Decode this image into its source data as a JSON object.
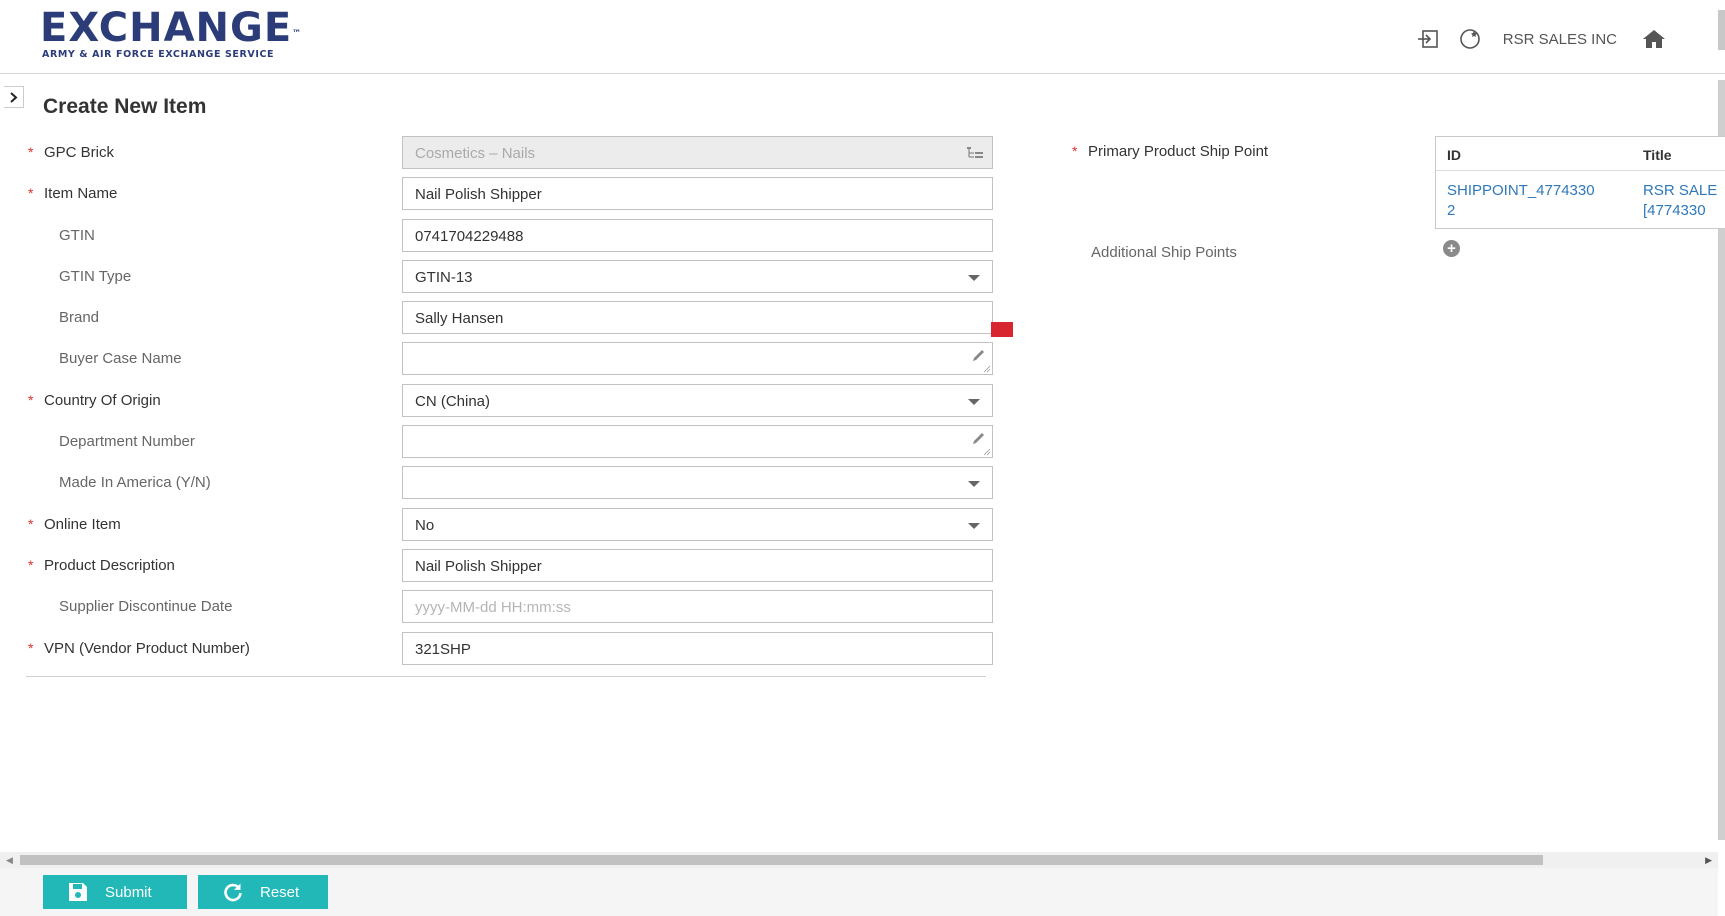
{
  "header": {
    "logo_text": "EXCHANGE",
    "logo_tm": "™",
    "logo_subtitle": "ARMY & AIR FORCE EXCHANGE SERVICE",
    "company": "RSR SALES INC"
  },
  "page": {
    "title": "Create New Item"
  },
  "form": {
    "fields": [
      {
        "label": "GPC Brick",
        "required": true,
        "value": "Cosmetics – Nails",
        "type": "tree"
      },
      {
        "label": "Item Name",
        "required": true,
        "value": "Nail Polish Shipper",
        "type": "text"
      },
      {
        "label": "GTIN",
        "required": false,
        "value": "0741704229488",
        "type": "text"
      },
      {
        "label": "GTIN Type",
        "required": false,
        "value": "GTIN-13",
        "type": "select"
      },
      {
        "label": "Brand",
        "required": false,
        "value": "Sally Hansen",
        "type": "text"
      },
      {
        "label": "Buyer Case Name",
        "required": false,
        "value": "",
        "type": "textarea"
      },
      {
        "label": "Country Of Origin",
        "required": true,
        "value": "CN (China)",
        "type": "select"
      },
      {
        "label": "Department Number",
        "required": false,
        "value": "",
        "type": "textarea"
      },
      {
        "label": "Made In America (Y/N)",
        "required": false,
        "value": "",
        "type": "select"
      },
      {
        "label": "Online Item",
        "required": true,
        "value": "No",
        "type": "select"
      },
      {
        "label": "Product Description",
        "required": true,
        "value": "Nail Polish Shipper",
        "type": "text"
      },
      {
        "label": "Supplier Discontinue Date",
        "required": false,
        "value": "",
        "placeholder": "yyyy-MM-dd HH:mm:ss",
        "type": "date"
      },
      {
        "label": "VPN (Vendor Product Number)",
        "required": true,
        "value": "321SHP",
        "type": "text"
      }
    ]
  },
  "ship_points": {
    "primary_label": "Primary Product Ship Point",
    "additional_label": "Additional Ship Points",
    "columns": [
      "ID",
      "Title"
    ],
    "rows": [
      {
        "id_line1": "SHIPPOINT_4774330",
        "id_line2": "2",
        "title_line1": "RSR SALE",
        "title_line2": "[4774330"
      }
    ]
  },
  "buttons": {
    "submit": "Submit",
    "reset": "Reset"
  },
  "colors": {
    "brand": "#2b3c78",
    "accent": "#22b8b8",
    "required": "#e0302c",
    "link": "#2f78b9"
  }
}
